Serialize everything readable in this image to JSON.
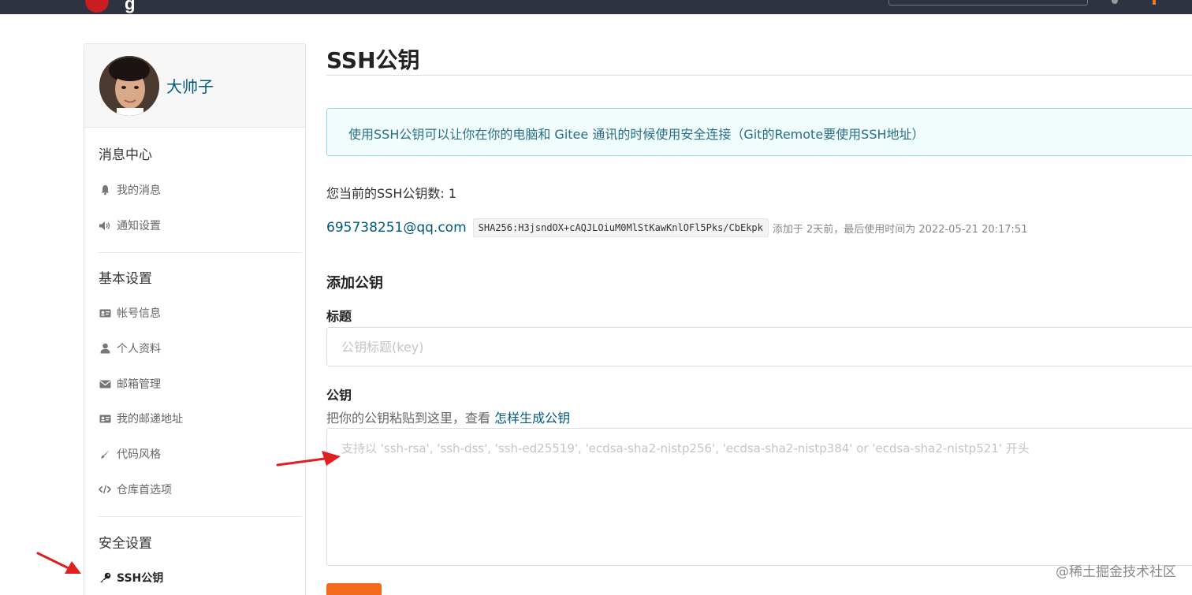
{
  "header": {
    "logo_letter": "g",
    "brand_color": "#c71d23"
  },
  "sidebar": {
    "username": "大帅子",
    "sections": [
      {
        "title": "消息中心",
        "items": [
          {
            "label": "我的消息",
            "icon": "bell-icon"
          },
          {
            "label": "通知设置",
            "icon": "volume-icon"
          }
        ]
      },
      {
        "title": "基本设置",
        "items": [
          {
            "label": "帐号信息",
            "icon": "id-card-icon"
          },
          {
            "label": "个人资料",
            "icon": "user-icon"
          },
          {
            "label": "邮箱管理",
            "icon": "envelope-icon"
          },
          {
            "label": "我的邮递地址",
            "icon": "address-card-icon"
          },
          {
            "label": "代码风格",
            "icon": "brush-icon"
          },
          {
            "label": "仓库首选项",
            "icon": "code-icon"
          }
        ]
      },
      {
        "title": "安全设置",
        "items": [
          {
            "label": "SSH公钥",
            "icon": "key-icon",
            "active": true
          }
        ]
      }
    ]
  },
  "main": {
    "title": "SSH公钥",
    "notice": "使用SSH公钥可以让你在你的电脑和 Gitee 通讯的时候使用安全连接（Git的Remote要使用SSH地址）",
    "count_text": "您当前的SSH公钥数: 1",
    "keys": [
      {
        "email": "695738251@qq.com",
        "fingerprint": "SHA256:H3jsndOX+cAQJLOiuM0MlStKawKnlOFl5Pks/CbEkpk",
        "meta": "添加于 2天前，最后使用时间为 2022-05-21 20:17:51"
      }
    ],
    "add_title": "添加公钥",
    "title_label": "标题",
    "title_placeholder": "公钥标题(key)",
    "key_label": "公钥",
    "help_prefix": "把你的公钥粘贴到这里，查看",
    "help_link": "怎样生成公钥",
    "key_placeholder": "支持以 'ssh-rsa', 'ssh-dss', 'ssh-ed25519', 'ecdsa-sha2-nistp256', 'ecdsa-sha2-nistp384' or 'ecdsa-sha2-nistp521' 开头",
    "accent_color": "#f26b1d"
  },
  "watermark": "@稀土掘金技术社区",
  "annotations": {
    "arrow_color": "#e02020"
  }
}
